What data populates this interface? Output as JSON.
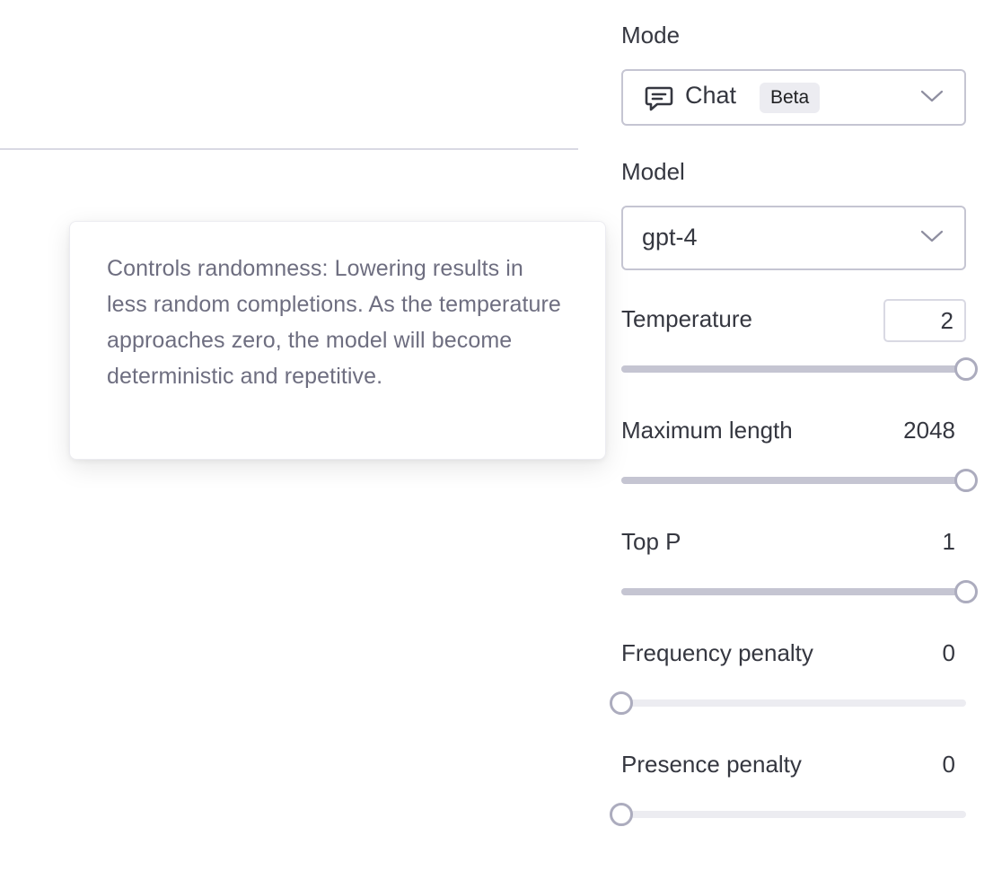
{
  "tooltip": {
    "text": "Controls randomness: Lowering results in less random completions. As the temperature approaches zero, the model will become deterministic and repetitive."
  },
  "mode": {
    "label": "Mode",
    "value": "Chat",
    "badge": "Beta",
    "icon": "chat-bubble-icon"
  },
  "model": {
    "label": "Model",
    "value": "gpt-4"
  },
  "temperature": {
    "label": "Temperature",
    "value": "2",
    "fraction": 1
  },
  "max_length": {
    "label": "Maximum length",
    "value": "2048",
    "fraction": 1
  },
  "top_p": {
    "label": "Top P",
    "value": "1",
    "fraction": 1
  },
  "frequency_penalty": {
    "label": "Frequency penalty",
    "value": "0",
    "fraction": 0
  },
  "presence_penalty": {
    "label": "Presence penalty",
    "value": "0",
    "fraction": 0
  },
  "colors": {
    "track": "#ececf1",
    "track_fill": "#c5c5d2",
    "thumb_border": "#acacbe",
    "text": "#353740",
    "muted_text": "#6e6e80"
  }
}
